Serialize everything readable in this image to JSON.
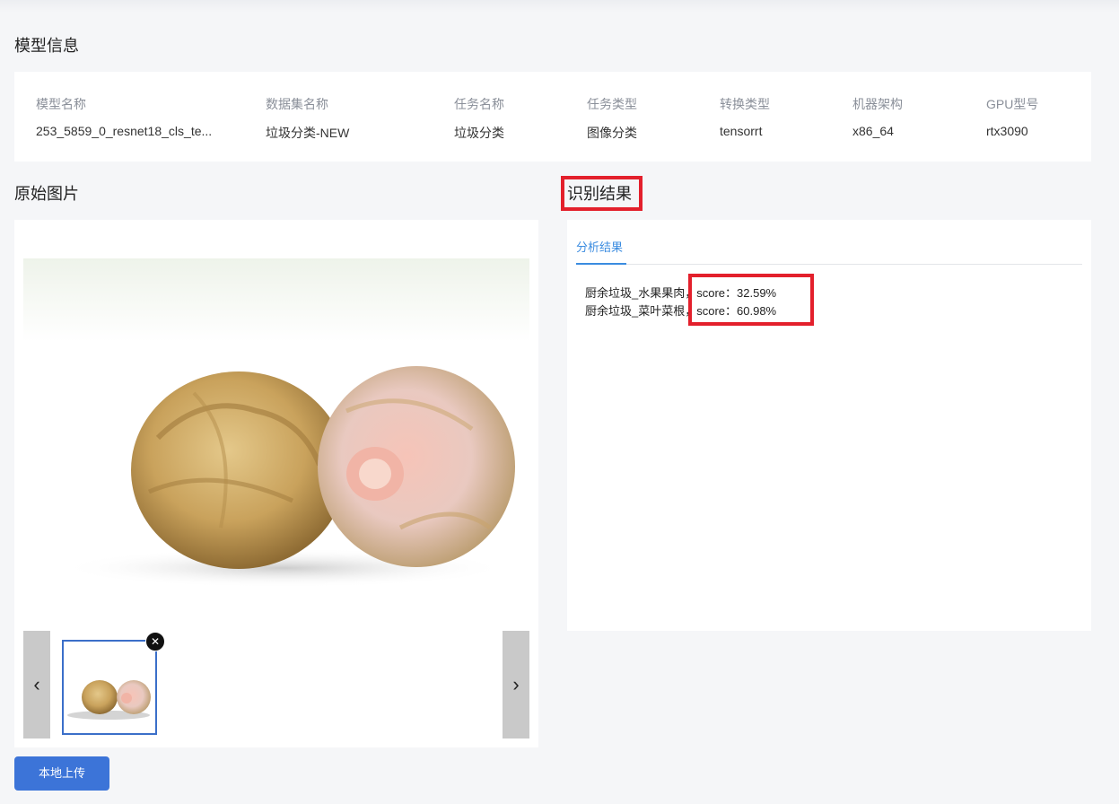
{
  "model_info": {
    "title": "模型信息",
    "columns": [
      {
        "label": "模型名称",
        "value": "253_5859_0_resnet18_cls_te..."
      },
      {
        "label": "数据集名称",
        "value": "垃圾分类-NEW"
      },
      {
        "label": "任务名称",
        "value": "垃圾分类"
      },
      {
        "label": "任务类型",
        "value": "图像分类"
      },
      {
        "label": "转换类型",
        "value": "tensorrt"
      },
      {
        "label": "机器架构",
        "value": "x86_64"
      },
      {
        "label": "GPU型号",
        "value": "rtx3090"
      }
    ]
  },
  "original": {
    "title": "原始图片",
    "prev_icon": "‹",
    "next_icon": "›",
    "close_icon": "✕",
    "upload_label": "本地上传"
  },
  "result": {
    "title": "识别结果",
    "tab_label": "分析结果",
    "lines": [
      "厨余垃圾_水果果肉，score：32.59%",
      "厨余垃圾_菜叶菜根，score：60.98%"
    ]
  },
  "colors": {
    "accent": "#3b8ce0",
    "button": "#3c74d8",
    "highlight": "#e3202c"
  }
}
